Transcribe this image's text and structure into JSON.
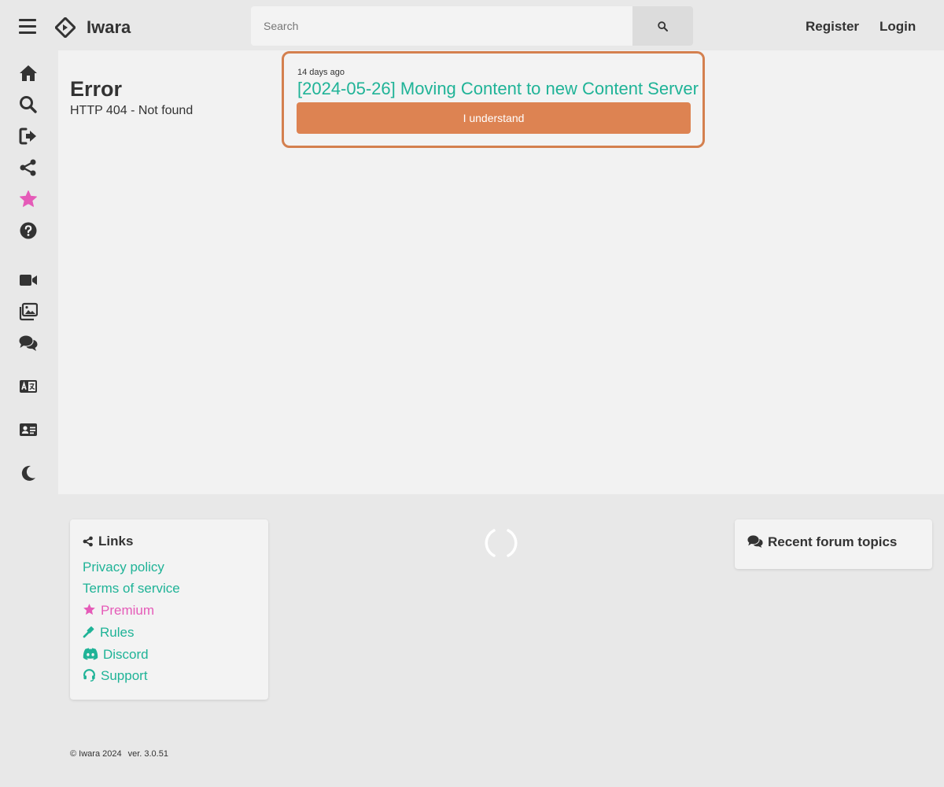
{
  "header": {
    "brand": "Iwara",
    "search_placeholder": "Search",
    "register_label": "Register",
    "login_label": "Login"
  },
  "sidebar": {
    "icons": [
      "home-icon",
      "search-icon",
      "sign-in-icon",
      "share-icon",
      "star-icon",
      "help-icon",
      "video-icon",
      "images-icon",
      "comments-icon",
      "language-icon",
      "id-card-icon",
      "moon-icon"
    ]
  },
  "error": {
    "title": "Error",
    "message": "HTTP 404 - Not found"
  },
  "notice": {
    "time": "14 days ago",
    "title": "[2024-05-26] Moving Content to new Content Server",
    "button_label": "I understand"
  },
  "links": {
    "heading": "Links",
    "items": [
      "Privacy policy",
      "Terms of service",
      "Premium",
      "Rules",
      "Discord",
      "Support"
    ]
  },
  "forum": {
    "heading": "Recent forum topics"
  },
  "footer": {
    "copyright": "© Iwara 2024",
    "version": "ver. 3.0.51"
  },
  "colors": {
    "accent": "#1fb397",
    "premium": "#e55bb8",
    "notice_border": "#d4804f",
    "notice_button": "#dd8352"
  }
}
